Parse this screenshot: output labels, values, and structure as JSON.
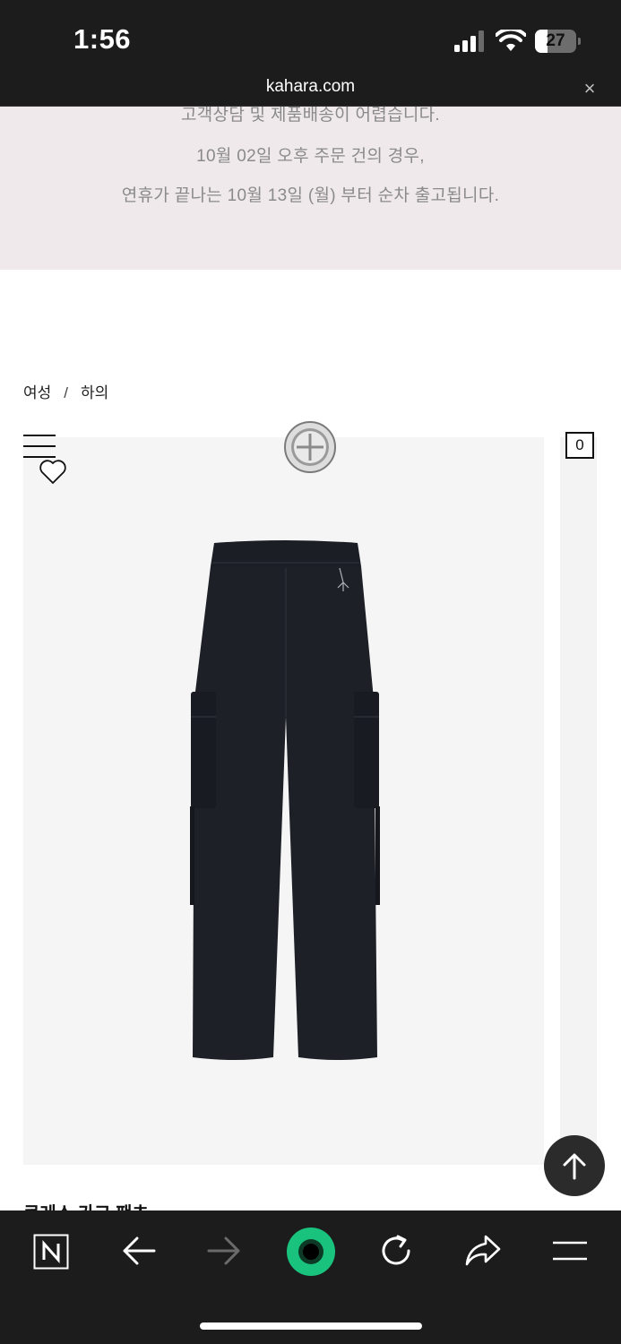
{
  "status_bar": {
    "time": "1:56",
    "battery": "27"
  },
  "browser": {
    "url": "kahara.com",
    "close_glyph": "×"
  },
  "notice": {
    "lines": [
      "고객상담 및 제품배송이 어렵습니다.",
      "10월 02일 오후 주문 건의 경우,",
      "연휴가 끝나는 10월 13일 (월) 부터 순차 출고됩니다."
    ]
  },
  "breadcrumb": {
    "items": [
      "여성",
      "하의"
    ],
    "separator": "/"
  },
  "cart": {
    "count": "0"
  },
  "product": {
    "name": "쿠레스 카고 팬츠"
  },
  "icons": {
    "menu": "hamburger-menu-icon",
    "wishlist": "heart-icon",
    "logo": "brand-logo-badge",
    "scroll_top": "arrow-up-icon"
  },
  "toolbar": {
    "items": [
      "n-home-icon",
      "back-arrow-icon",
      "forward-arrow-icon",
      "green-assistant-icon",
      "reload-icon",
      "share-icon",
      "menu-icon"
    ]
  },
  "colors": {
    "bar_bg": "#1c1c1c",
    "notice_bg": "#efe9ec",
    "accent_green": "#19c37d",
    "product_bg": "#f5f5f5"
  }
}
